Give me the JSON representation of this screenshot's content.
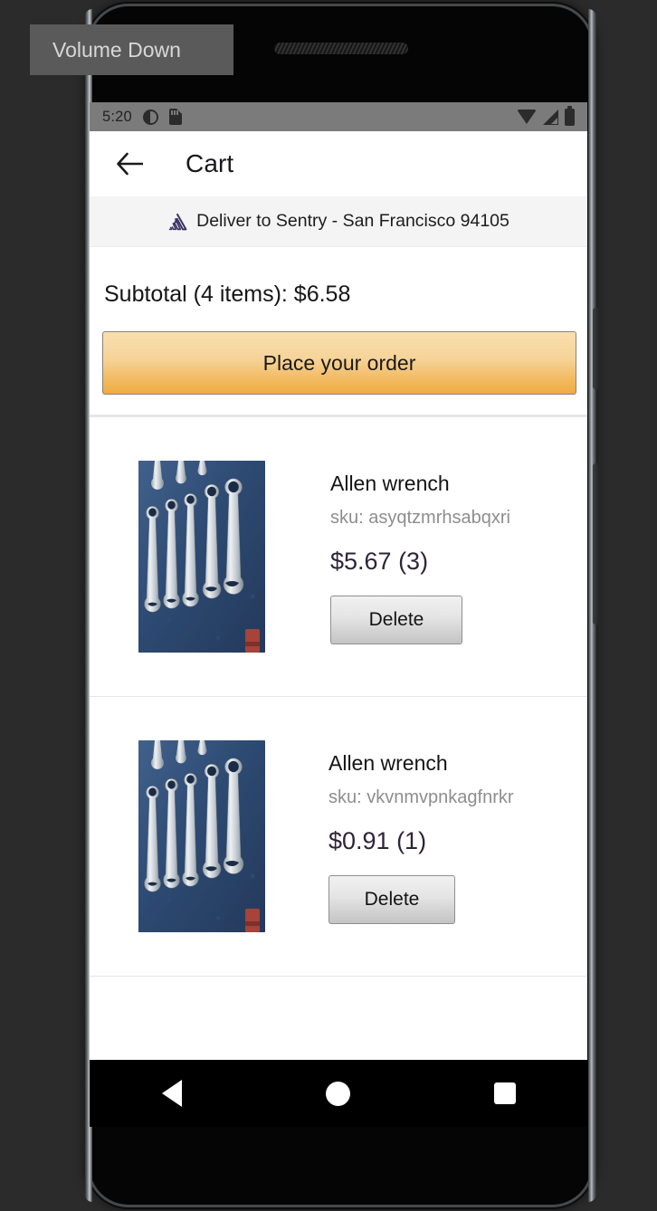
{
  "overlay": {
    "toast_label": "Volume Down"
  },
  "status_bar": {
    "time": "5:20",
    "left_icons": [
      "do-not-disturb-icon",
      "sd-card-icon"
    ],
    "right_icons": [
      "wifi-icon",
      "cellular-signal-icon",
      "battery-icon"
    ]
  },
  "app_bar": {
    "back_icon": "back-arrow-icon",
    "title": "Cart"
  },
  "deliver_banner": {
    "logo_icon": "sentry-logo-icon",
    "text": "Deliver to Sentry - San Francisco 94105"
  },
  "summary": {
    "subtotal_text": "Subtotal (4 items): $6.58",
    "item_count": 4,
    "subtotal_amount": "$6.58",
    "order_button_label": "Place your order",
    "order_button_color": "#f2b95f"
  },
  "cart_items": [
    {
      "name": "Allen wrench",
      "sku": "sku: asyqtzmrhsabqxri",
      "price": "$5.67 (3)",
      "delete_label": "Delete",
      "thumb_alt": "wrenches-photo"
    },
    {
      "name": "Allen wrench",
      "sku": "sku: vkvnmvpnkagfnrkr",
      "price": "$0.91 (1)",
      "delete_label": "Delete",
      "thumb_alt": "wrenches-photo"
    }
  ],
  "nav_bar": {
    "back": "nav-back-icon",
    "home": "nav-home-icon",
    "recents": "nav-recents-icon"
  },
  "colors": {
    "price_text": "#2f2438",
    "sku_text": "#8e8e8e",
    "banner_bg": "#f4f4f4",
    "status_bar_bg": "#7b7b7b"
  }
}
